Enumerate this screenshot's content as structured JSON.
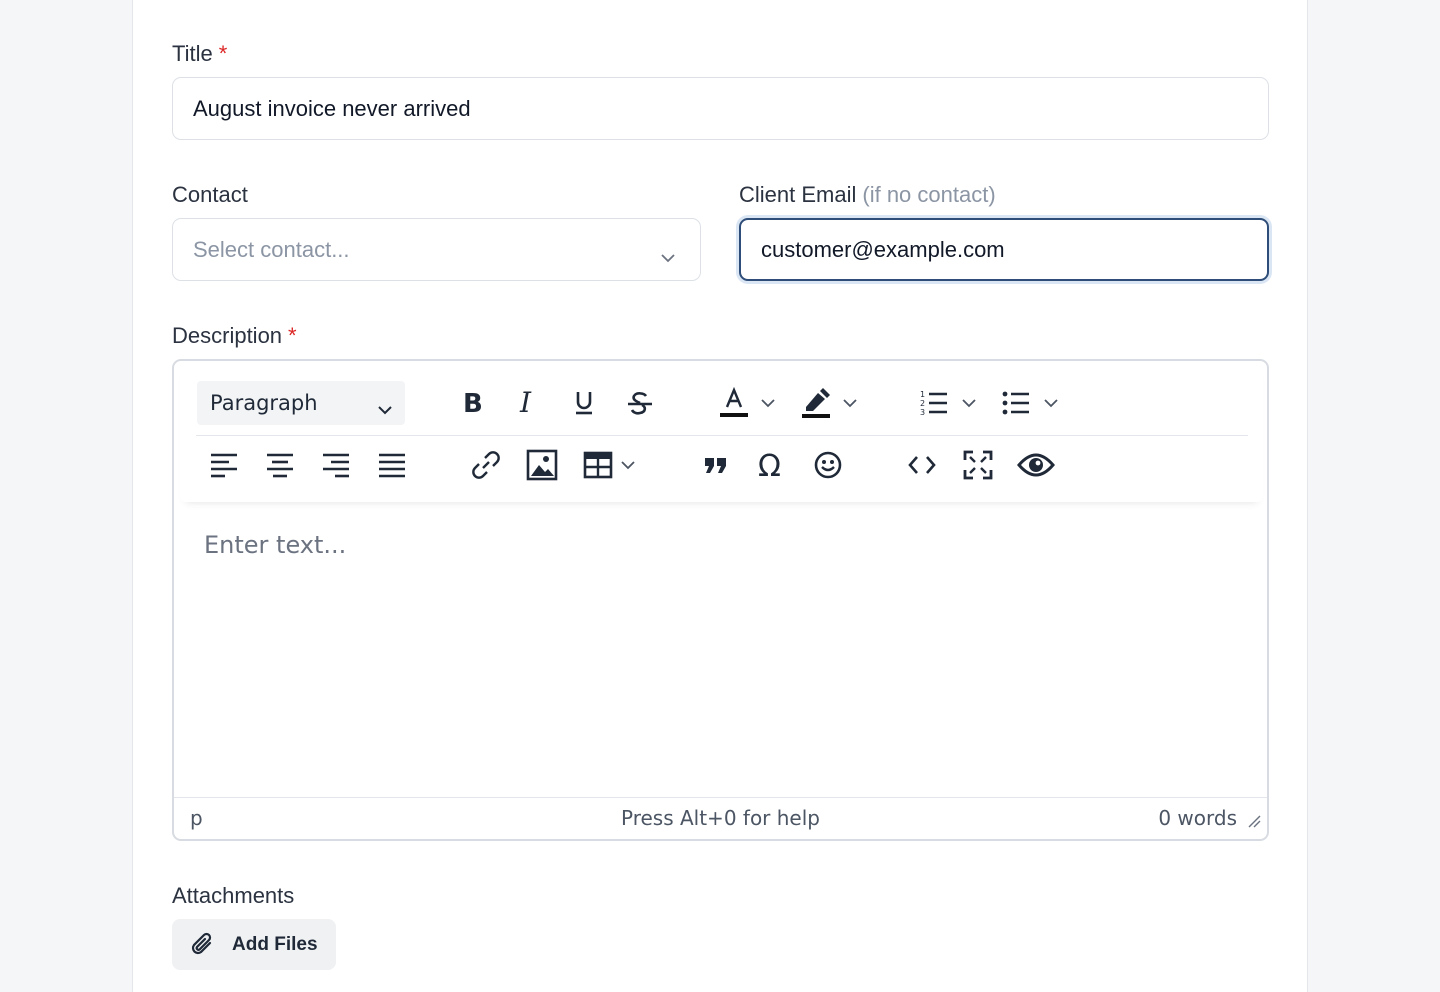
{
  "form": {
    "title_label": "Title",
    "title_required": "*",
    "title_value": "August invoice never arrived",
    "contact_label": "Contact",
    "contact_placeholder": "Select contact...",
    "email_label": "Client Email",
    "email_hint": "(if no contact)",
    "email_value": "customer@example.com",
    "description_label": "Description",
    "description_required": "*",
    "attachments_label": "Attachments",
    "add_files_label": "Add Files"
  },
  "editor": {
    "format_select": "Paragraph",
    "placeholder": "Enter text...",
    "status_path": "p",
    "status_help": "Press Alt+0 for help",
    "status_words": "0 words"
  },
  "icons": {
    "toolbar_row1": [
      "bold-icon",
      "italic-icon",
      "underline-icon",
      "strikethrough-icon",
      "text-color-icon",
      "highlight-icon",
      "numbered-list-icon",
      "bullet-list-icon"
    ],
    "toolbar_row2": [
      "align-left-icon",
      "align-center-icon",
      "align-right-icon",
      "align-justify-icon",
      "link-icon",
      "image-icon",
      "table-icon",
      "blockquote-icon",
      "special-char-icon",
      "emoji-icon",
      "code-icon",
      "fullscreen-icon",
      "preview-icon"
    ]
  },
  "colors": {
    "required": "#dc2626",
    "focus_border": "#2e4d78"
  }
}
